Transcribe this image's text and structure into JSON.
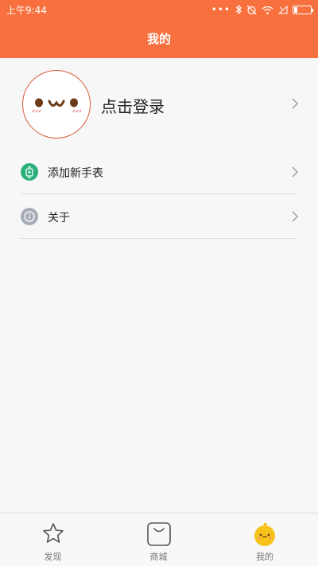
{
  "status": {
    "time": "上午9:44",
    "dots": "•••"
  },
  "header": {
    "title": "我的"
  },
  "profile": {
    "login_label": "点击登录"
  },
  "menu": [
    {
      "label": "添加新手表",
      "icon": "watch-icon",
      "color": "#2bb07a"
    },
    {
      "label": "关于",
      "icon": "info-icon",
      "color": "#a6adb8"
    }
  ],
  "tabs": [
    {
      "label": "发现",
      "icon": "star-icon"
    },
    {
      "label": "商城",
      "icon": "shopping-bag-icon"
    },
    {
      "label": "我的",
      "icon": "mascot-icon",
      "active": true
    }
  ],
  "colors": {
    "accent": "#f7703e",
    "background": "#f7f7f7"
  }
}
